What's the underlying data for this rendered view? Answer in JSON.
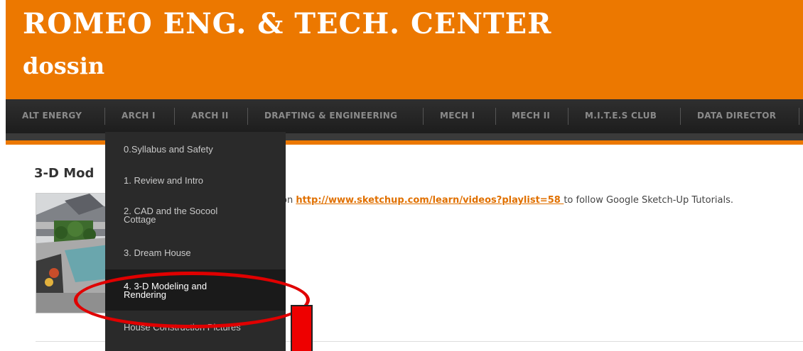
{
  "header": {
    "site_title": "ROMEO ENG. & TECH. CENTER",
    "tagline": "dossin",
    "colors": {
      "brand": "#ec7800",
      "nav_bg": "#262626",
      "dropdown_bg": "#2a2a2a",
      "annotation": "#e00000"
    }
  },
  "nav": {
    "items": [
      {
        "label": "ALT ENERGY"
      },
      {
        "label": "ARCH I"
      },
      {
        "label": "ARCH II"
      },
      {
        "label": "DRAFTING & ENGINEERING"
      },
      {
        "label": "MECH I"
      },
      {
        "label": "MECH II"
      },
      {
        "label": "M.I.T.E.S CLUB"
      },
      {
        "label": "DATA DIRECTOR"
      }
    ]
  },
  "dropdown": {
    "items": [
      {
        "label": "0.Syllabus and Safety"
      },
      {
        "label": "1. Review and Intro"
      },
      {
        "label": "2. CAD and the Socool Cottage"
      },
      {
        "label": "3. Dream House"
      },
      {
        "label": "4. 3-D Modeling and Rendering",
        "active": true
      },
      {
        "label": "House Construction Pictures"
      }
    ]
  },
  "post": {
    "title": "3-D Mod",
    "text_before": "on ",
    "link_text": "http://www.sketchup.com/learn/videos?playlist=58 ",
    "text_after": "to follow Google Sketch-Up Tutorials.",
    "thumbnail_icon": "3d-rendering-image"
  }
}
